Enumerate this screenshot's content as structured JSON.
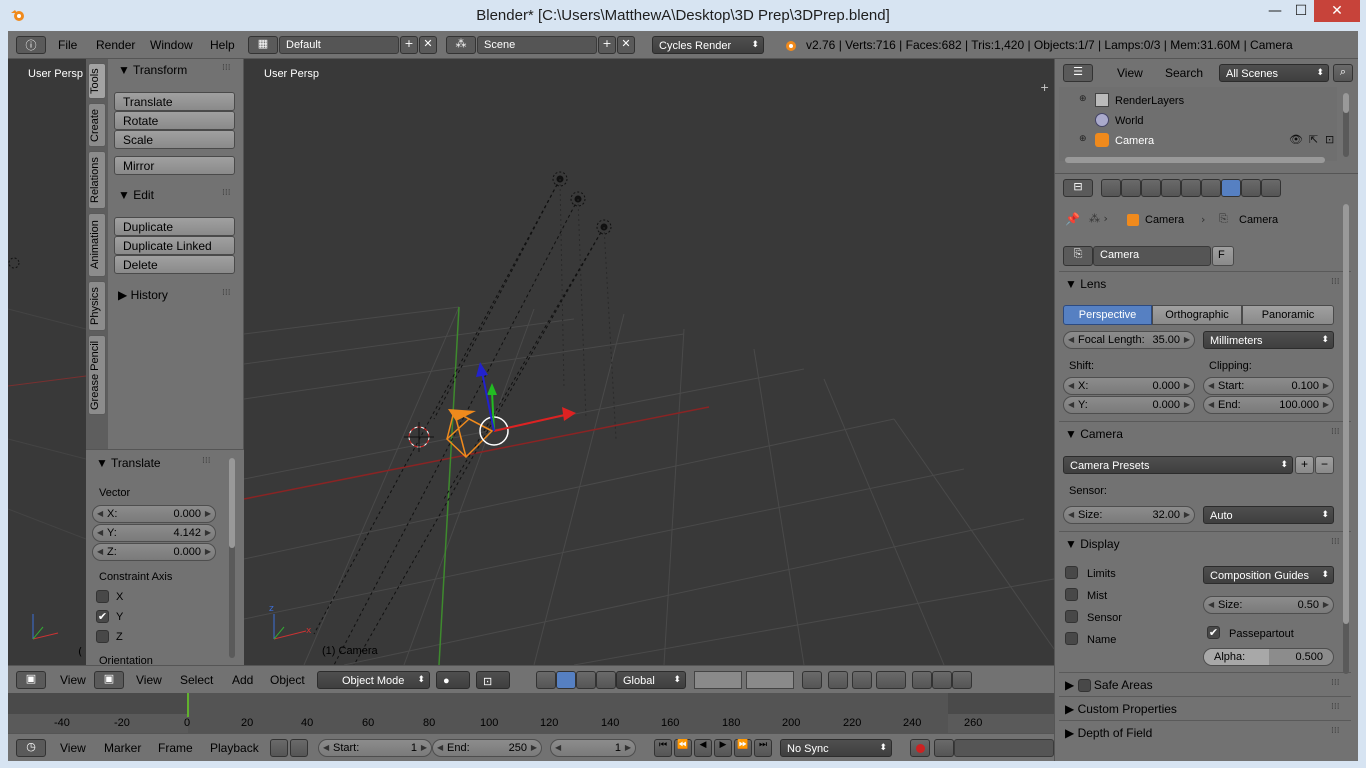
{
  "window": {
    "title": "Blender* [C:\\Users\\MatthewA\\Desktop\\3D Prep\\3DPrep.blend]",
    "minimize": "—",
    "maximize": "☐",
    "close": "✕"
  },
  "top_menu": {
    "items": [
      "File",
      "Render",
      "Window",
      "Help"
    ],
    "screen_layout": "Default",
    "scene": "Scene",
    "engine": "Cycles Render",
    "stats": "v2.76 | Verts:716 | Faces:682 | Tris:1,420 | Objects:1/7 | Lamps:0/3 | Mem:31.60M | Camera"
  },
  "left_view": {
    "label": "User Persp"
  },
  "toolshelf": {
    "tabs": [
      "Tools",
      "Create",
      "Relations",
      "Animation",
      "Physics",
      "Grease Pencil"
    ],
    "transform_header": "Transform",
    "transform_buttons": [
      "Translate",
      "Rotate",
      "Scale"
    ],
    "mirror": "Mirror",
    "edit_header": "Edit",
    "edit_buttons": [
      "Duplicate",
      "Duplicate Linked",
      "Delete"
    ],
    "history_header": "History"
  },
  "operator": {
    "header": "Translate",
    "vector_label": "Vector",
    "vector": [
      {
        "axis": "X:",
        "value": "0.000"
      },
      {
        "axis": "Y:",
        "value": "4.142"
      },
      {
        "axis": "Z:",
        "value": "0.000"
      }
    ],
    "constraint_label": "Constraint Axis",
    "constraints": [
      {
        "label": "X",
        "checked": false
      },
      {
        "label": "Y",
        "checked": true
      },
      {
        "label": "Z",
        "checked": false
      }
    ],
    "orientation_label": "Orientation"
  },
  "viewport": {
    "label": "User Persp",
    "object_label": "(1) Camera",
    "left_partial": "("
  },
  "view3d_header": {
    "menus": [
      "View",
      "Select",
      "Add",
      "Object"
    ],
    "left_partial": "View",
    "mode": "Object Mode",
    "orientation": "Global"
  },
  "timeline": {
    "ticks": [
      "-40",
      "-20",
      "0",
      "20",
      "40",
      "60",
      "80",
      "100",
      "120",
      "140",
      "160",
      "180",
      "200",
      "220",
      "240",
      "260"
    ],
    "menus": [
      "View",
      "Marker",
      "Frame",
      "Playback"
    ],
    "start_label": "Start:",
    "start": "1",
    "end_label": "End:",
    "end": "250",
    "current": "1",
    "sync": "No Sync"
  },
  "outliner": {
    "menus": [
      "View",
      "Search"
    ],
    "filter": "All Scenes",
    "items": [
      {
        "label": "RenderLayers",
        "icon": "renderlayers-icon"
      },
      {
        "label": "World",
        "icon": "world-icon"
      },
      {
        "label": "Camera",
        "icon": "camera-object-icon"
      }
    ]
  },
  "properties": {
    "breadcrumb": [
      "Camera",
      "Camera"
    ],
    "datablock": "Camera",
    "fake_user": "F",
    "lens": {
      "header": "Lens",
      "types": [
        "Perspective",
        "Orthographic",
        "Panoramic"
      ],
      "active_type": "Perspective",
      "focal_label": "Focal Length:",
      "focal_value": "35.00",
      "unit": "Millimeters",
      "shift_label": "Shift:",
      "shift_x": "0.000",
      "shift_y": "0.000",
      "clipping_label": "Clipping:",
      "clip_start_label": "Start:",
      "clip_start": "0.100",
      "clip_end_label": "End:",
      "clip_end": "100.000",
      "x_label": "X:",
      "y_label": "Y:"
    },
    "camera": {
      "header": "Camera",
      "presets": "Camera Presets",
      "sensor_label": "Sensor:",
      "size_label": "Size:",
      "size_value": "32.00",
      "fit": "Auto"
    },
    "display": {
      "header": "Display",
      "checks": [
        {
          "label": "Limits",
          "checked": false
        },
        {
          "label": "Mist",
          "checked": false
        },
        {
          "label": "Sensor",
          "checked": false
        },
        {
          "label": "Name",
          "checked": false
        }
      ],
      "guides": "Composition Guides",
      "size_label": "Size:",
      "size_value": "0.50",
      "passepartout": "Passepartout",
      "passepartout_checked": true,
      "alpha_label": "Alpha:",
      "alpha_value": "0.500"
    },
    "collapsed": [
      "Safe Areas",
      "Custom Properties",
      "Depth of Field"
    ]
  },
  "colors": {
    "active_blue": "#5680c2",
    "selected_orange": "#f08a1c",
    "viewport_bg": "#393939",
    "x_axis": "#8a2424",
    "y_axis": "#3e8a2e"
  }
}
